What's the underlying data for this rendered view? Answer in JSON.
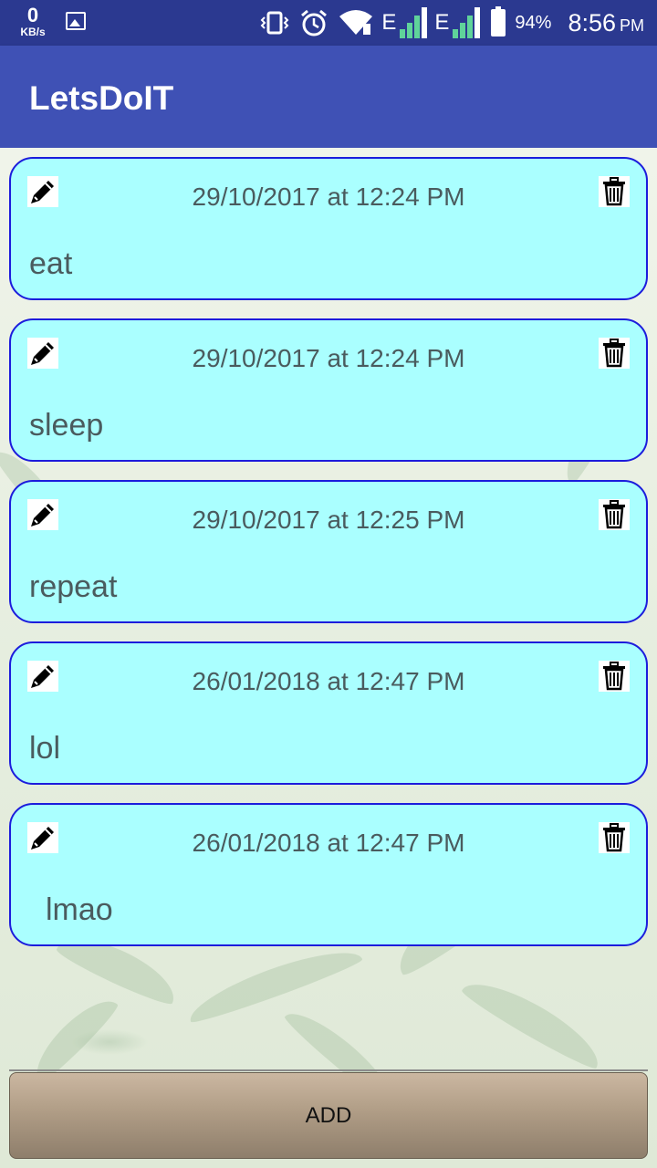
{
  "status_bar": {
    "net_speed_value": "0",
    "net_speed_unit": "KB/s",
    "network_type_1": "E",
    "network_type_2": "E",
    "battery": "94%",
    "time": "8:56",
    "ampm": "PM"
  },
  "app": {
    "title": "LetsDoIT"
  },
  "tasks": [
    {
      "date": "29/10/2017 at 12:24 PM",
      "text": "eat"
    },
    {
      "date": "29/10/2017 at 12:24 PM",
      "text": "sleep"
    },
    {
      "date": "29/10/2017 at 12:25 PM",
      "text": "repeat"
    },
    {
      "date": "26/01/2018 at 12:47 PM",
      "text": "lol"
    },
    {
      "date": "26/01/2018 at 12:47 PM",
      "text": "lmao"
    }
  ],
  "icons": {
    "edit": "pencil-icon",
    "delete": "trash-icon"
  },
  "add_button": {
    "label": "ADD"
  },
  "colors": {
    "app_bar": "#3f51b5",
    "status_bar": "#2b3990",
    "card_fill": "#aaffff",
    "card_border": "#1c1cdc"
  }
}
